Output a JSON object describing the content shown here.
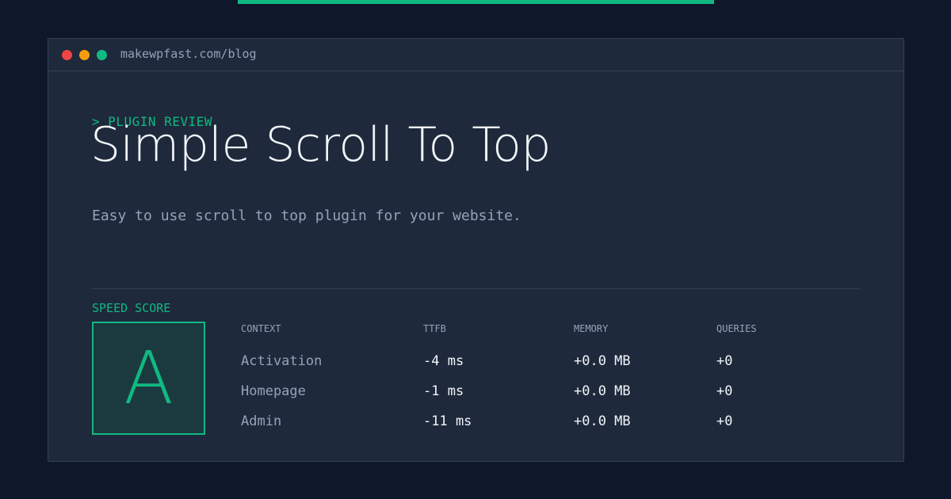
{
  "window": {
    "url": "makewpfast.com/blog"
  },
  "hero": {
    "kicker": "> PLUGIN REVIEW",
    "title": "Simple Scroll To Top",
    "description": "Easy to use scroll to top plugin for your website."
  },
  "speed": {
    "label": "SPEED SCORE",
    "grade": "A",
    "columns": [
      "CONTEXT",
      "TTFB",
      "MEMORY",
      "QUERIES"
    ],
    "rows": [
      {
        "context": "Activation",
        "ttfb": "-4 ms",
        "memory": "+0.0 MB",
        "queries": "+0"
      },
      {
        "context": "Homepage",
        "ttfb": "-1 ms",
        "memory": "+0.0 MB",
        "queries": "+0"
      },
      {
        "context": "Admin",
        "ttfb": "-11 ms",
        "memory": "+0.0 MB",
        "queries": "+0"
      }
    ]
  },
  "colors": {
    "background": "#0f172a",
    "panel": "#1e293b",
    "accent": "#10b981",
    "text": "#f1f5f9",
    "muted": "#94a3b8",
    "close_dot": "#ef4444",
    "minimize_dot": "#f59e0b",
    "maximize_dot": "#10b981"
  }
}
